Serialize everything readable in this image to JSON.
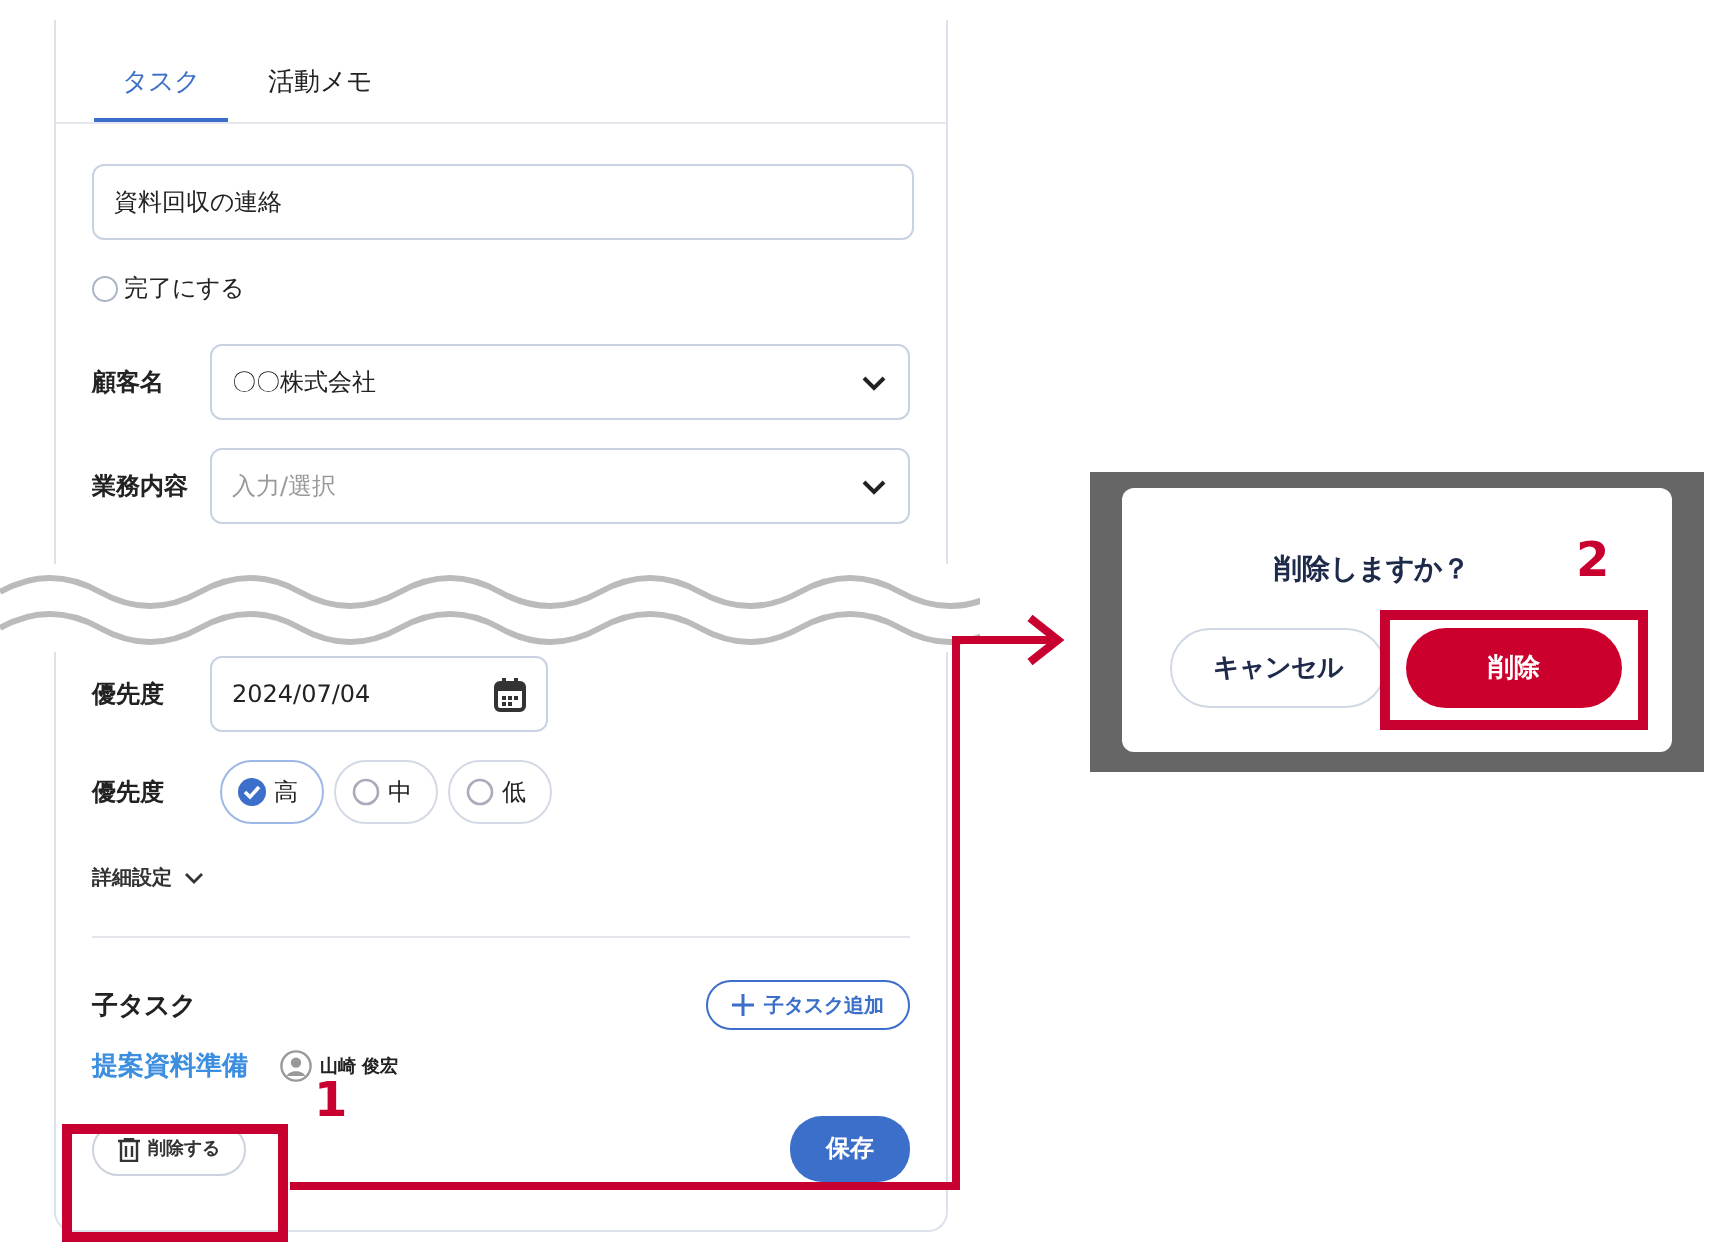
{
  "tabs": [
    {
      "label": "タスク",
      "selected": true
    },
    {
      "label": "活動メモ",
      "selected": false
    }
  ],
  "title_field": {
    "value": "資料回収の連絡"
  },
  "complete": {
    "label": "完了にする",
    "checked": false
  },
  "fields": [
    {
      "kind": "select",
      "label": "顧客名",
      "value": "〇〇株式会社"
    },
    {
      "kind": "select",
      "label": "業務内容",
      "placeholder": "入力/選択"
    },
    {
      "kind": "date",
      "label": "優先度",
      "value": "2024/07/04"
    }
  ],
  "priority": {
    "label": "優先度",
    "options": [
      {
        "label": "高",
        "selected": true
      },
      {
        "label": "中",
        "selected": false
      },
      {
        "label": "低",
        "selected": false
      }
    ]
  },
  "details_toggle": "詳細設定",
  "subtasks": {
    "heading": "子タスク",
    "add_button": "子タスク追加",
    "items": [
      {
        "title": "提案資料準備",
        "assignee": "山崎 俊宏"
      }
    ]
  },
  "actions": {
    "delete": "削除する",
    "save": "保存"
  },
  "dialog": {
    "title": "削除しますか？",
    "buttons": [
      {
        "kind": "cancel",
        "label": "キャンセル"
      },
      {
        "kind": "danger",
        "label": "削除"
      }
    ]
  },
  "annotations": [
    {
      "label": "1"
    },
    {
      "label": "2"
    }
  ]
}
